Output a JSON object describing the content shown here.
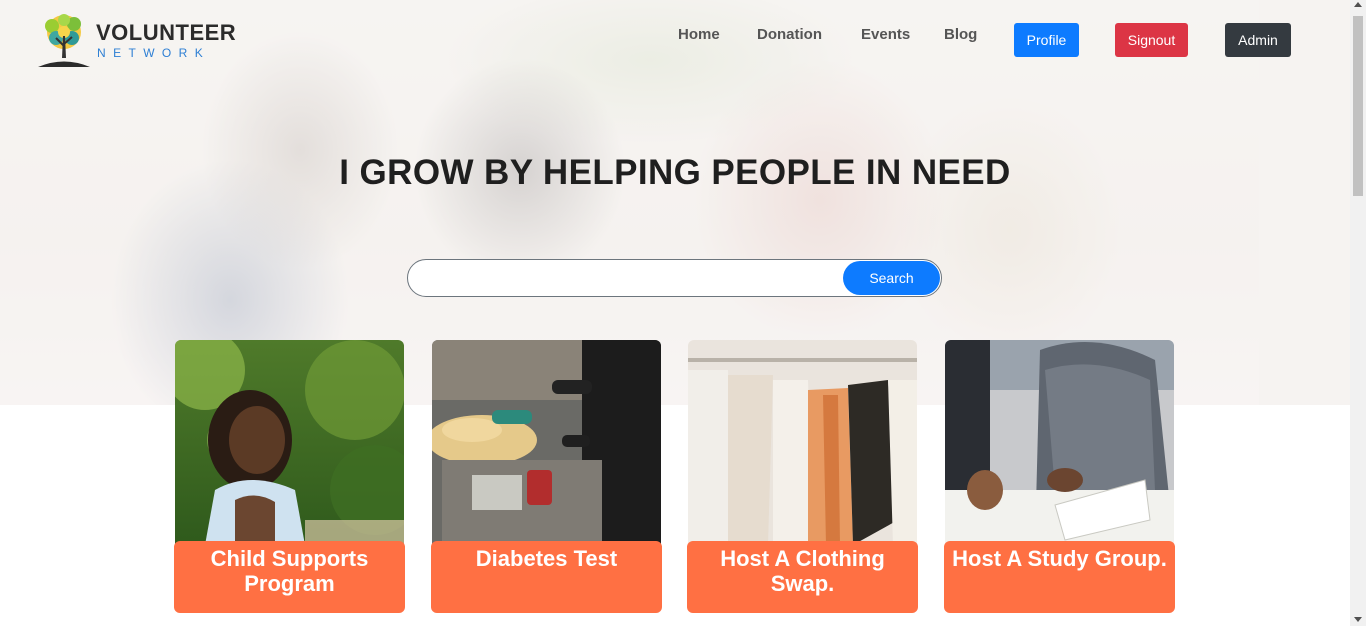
{
  "logo": {
    "title": "VOLUNTEER",
    "subtitle": "NETWORK",
    "icon": "tree-icon"
  },
  "nav": {
    "links": [
      "Home",
      "Donation",
      "Events",
      "Blog"
    ],
    "profile_label": "Profile",
    "signout_label": "Signout",
    "admin_label": "Admin"
  },
  "hero": {
    "headline": "I GROW BY HELPING PEOPLE IN NEED"
  },
  "search": {
    "value": "",
    "placeholder": "",
    "button_label": "Search"
  },
  "cards": [
    {
      "title": "Child Supports Program",
      "image": "child-photo"
    },
    {
      "title": "Diabetes Test",
      "image": "food-drive-photo"
    },
    {
      "title": "Host A Clothing Swap.",
      "image": "clothing-rack-photo"
    },
    {
      "title": "Host A Study Group.",
      "image": "study-group-photo"
    }
  ],
  "colors": {
    "primary": "#0d7bff",
    "danger": "#dc3545",
    "dark": "#343a40",
    "card_accent": "#ff7043",
    "logo_blue": "#2e7fd4"
  }
}
